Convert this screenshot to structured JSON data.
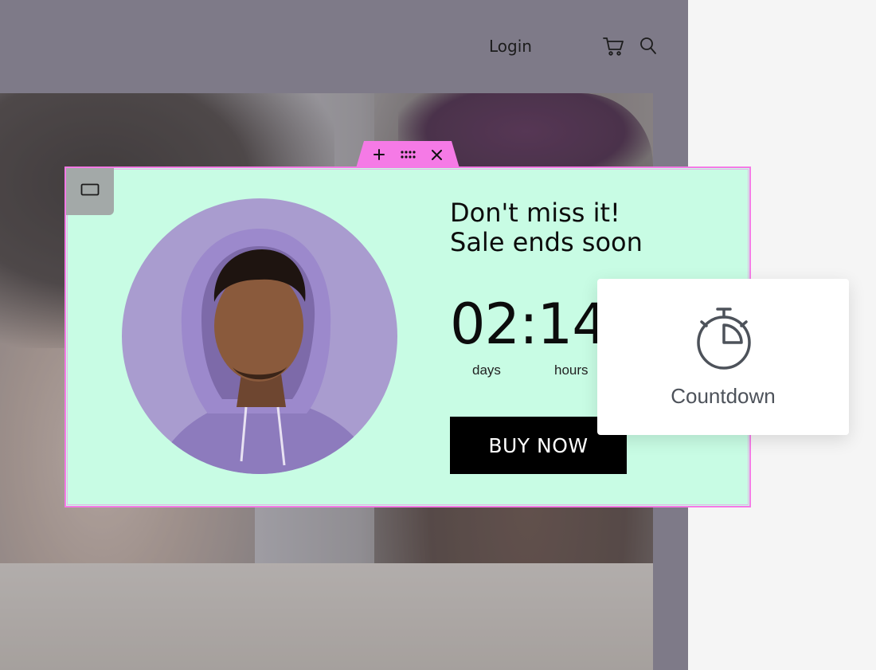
{
  "header": {
    "login_label": "Login",
    "icons": [
      "cart-icon",
      "search-icon"
    ]
  },
  "editor_toolbar": {
    "icons": [
      "add-icon",
      "drag-handle-icon",
      "close-icon"
    ]
  },
  "popup": {
    "device_toggle_icon": "desktop-icon",
    "headline_line1": "Don't miss it!",
    "headline_line2": "Sale ends soon",
    "countdown_value": "02:14",
    "label_days": "days",
    "label_hours": "hours",
    "cta_label": "BUY NOW",
    "background_color": "#c8fce4",
    "frame_color": "#f57ae6"
  },
  "widget": {
    "label": "Countdown",
    "icon": "stopwatch-icon"
  }
}
